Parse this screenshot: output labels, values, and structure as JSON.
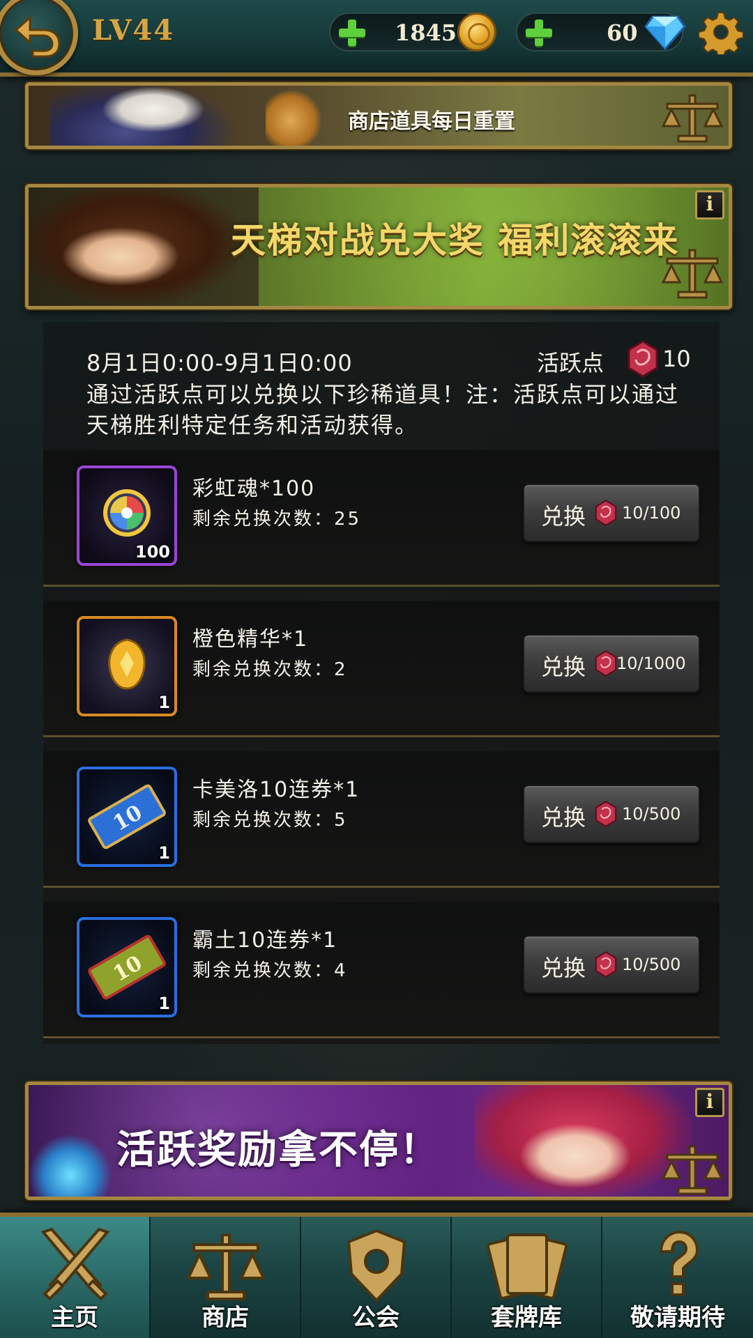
{
  "header": {
    "level": "LV44",
    "coins": "1845",
    "gems": "60"
  },
  "banners": {
    "shop_text": "商店道具每日重置",
    "ladder_text": "天梯对战兑大奖  福利滚滚来",
    "active_text": "活跃奖励拿不停！",
    "info_label": "i"
  },
  "event": {
    "period": "8月1日0:00-9月1日0:00",
    "active_label": "活跃点",
    "active_value": "10",
    "description": "通过活跃点可以兑换以下珍稀道具！注：活跃点可以通过天梯胜利特定任务和活动获得。"
  },
  "items": [
    {
      "name": "彩虹魂*100",
      "remaining": "剩余兑换次数：25",
      "qty": "100",
      "button": "兑换",
      "cost": "10/100"
    },
    {
      "name": "橙色精华*1",
      "remaining": "剩余兑换次数：2",
      "qty": "1",
      "button": "兑换",
      "cost": "10/1000"
    },
    {
      "name": "卡美洛10连券*1",
      "remaining": "剩余兑换次数：5",
      "qty": "1",
      "button": "兑换",
      "cost": "10/500"
    },
    {
      "name": "霸土10连券*1",
      "remaining": "剩余兑换次数：4",
      "qty": "1",
      "button": "兑换",
      "cost": "10/500"
    }
  ],
  "nav": [
    {
      "label": "主页",
      "icon": "crossed-swords-icon"
    },
    {
      "label": "商店",
      "icon": "scales-icon"
    },
    {
      "label": "公会",
      "icon": "guild-emblem-icon"
    },
    {
      "label": "套牌库",
      "icon": "cards-icon"
    },
    {
      "label": "敬请期待",
      "icon": "question-mark-icon"
    }
  ],
  "colors": {
    "accent_gold": "#b08a3e",
    "text": "#f4f1e8",
    "plus_green": "#5fcf3c"
  }
}
